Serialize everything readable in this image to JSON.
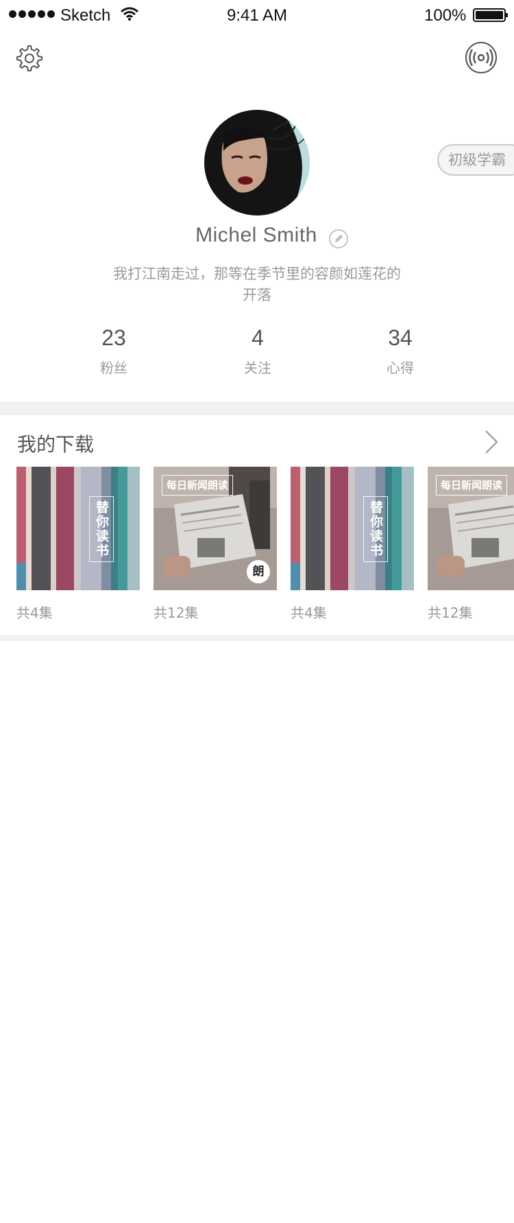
{
  "status_bar": {
    "carrier": "Sketch",
    "time": "9:41 AM",
    "battery": "100%"
  },
  "icons": {
    "settings": "gear-icon",
    "broadcast": "broadcast-icon",
    "edit": "pencil-icon",
    "more": "chevron-right-icon"
  },
  "profile": {
    "level_badge": "初级学霸",
    "name": "Michel Smith",
    "bio": "我打江南走过，那等在季节里的容颜如莲花的开落"
  },
  "stats": [
    {
      "value": "23",
      "label": "粉丝"
    },
    {
      "value": "4",
      "label": "关注"
    },
    {
      "value": "34",
      "label": "心得"
    }
  ],
  "downloads": {
    "title": "我的下载",
    "items": [
      {
        "cover": "books",
        "badge": "替你读书",
        "count": "共4集"
      },
      {
        "cover": "newspaper",
        "badge": "每日新闻朗读",
        "round_badge": "朗",
        "count": "共12集"
      },
      {
        "cover": "books",
        "badge": "替你读书",
        "count": "共4集"
      },
      {
        "cover": "newspaper",
        "badge": "每日新闻朗读",
        "count": "共12集"
      }
    ]
  },
  "colors": {
    "divider": "#f0f2f2",
    "text_primary": "#555555",
    "text_secondary": "#9a9a9a"
  }
}
